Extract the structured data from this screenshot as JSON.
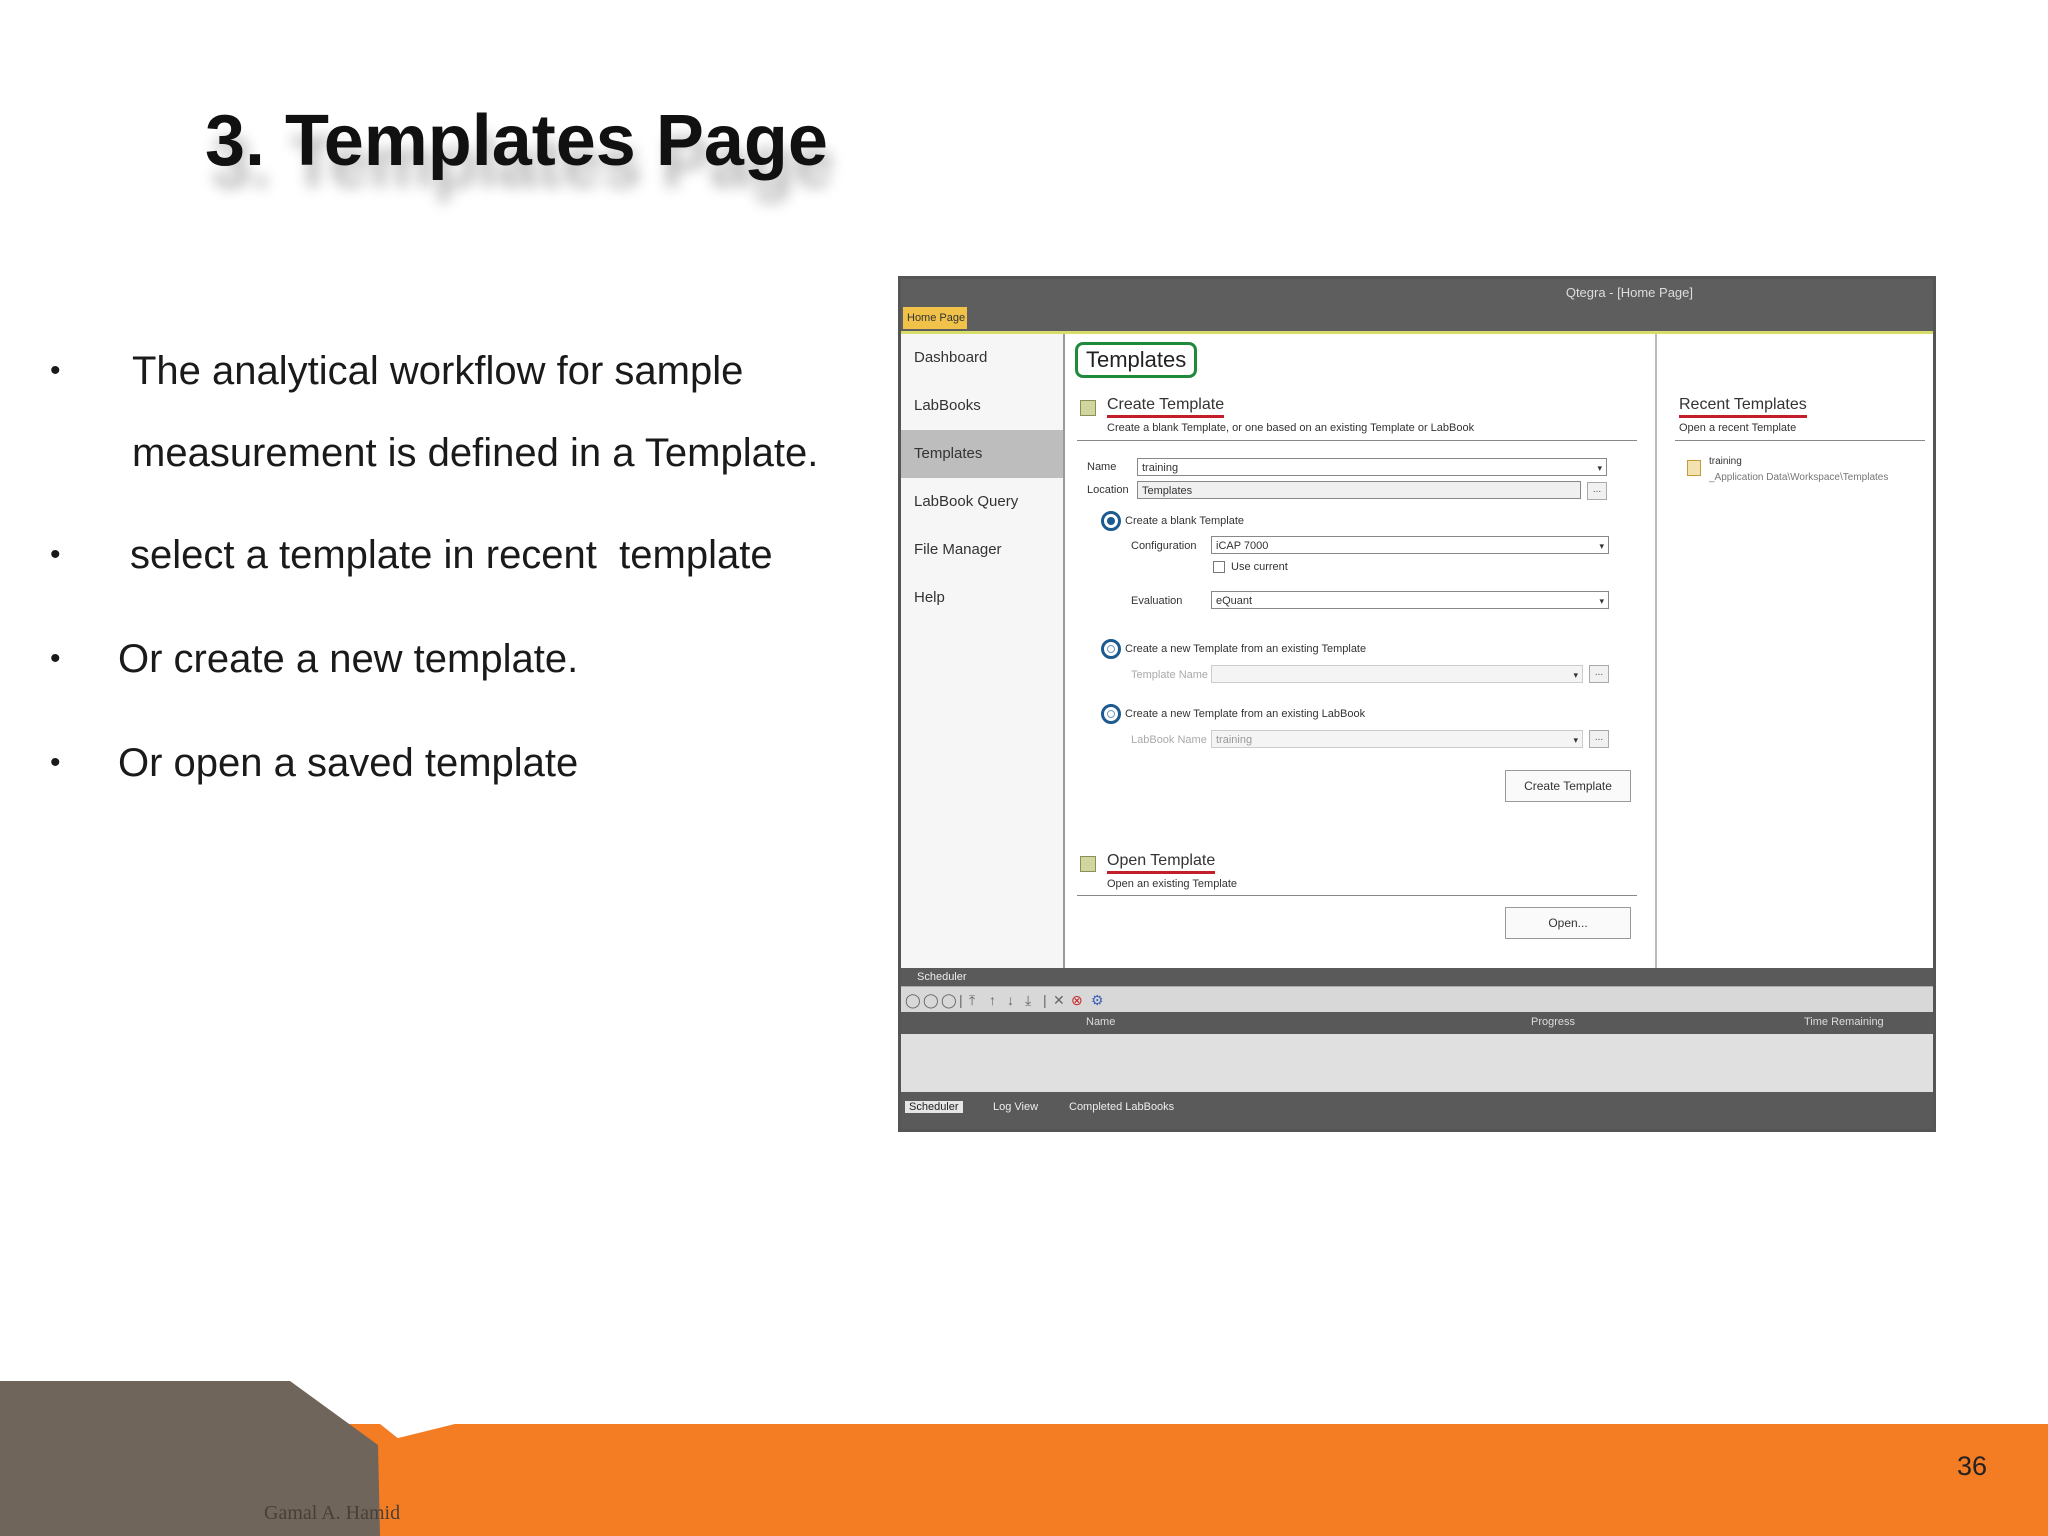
{
  "slide": {
    "title": "3. Templates Page",
    "bullets": [
      "The analytical workflow for sample measurement is defined in a Template.",
      "select a template in recent  template",
      "Or create a new template.",
      "Or open a saved template"
    ],
    "page_number": "36",
    "author": "Gamal A. Hamid"
  },
  "app": {
    "window_title": "Qtegra - [Home Page]",
    "home_tab": "Home Page",
    "nav": [
      "Dashboard",
      "LabBooks",
      "Templates",
      "LabBook Query",
      "File Manager",
      "Help"
    ],
    "active_nav": "Templates",
    "heading": "Templates",
    "create": {
      "title": "Create Template",
      "subtitle": "Create a blank Template, or one based on an existing Template or LabBook",
      "name_label": "Name",
      "name_value": "training",
      "location_label": "Location",
      "location_value": "Templates",
      "option_blank": "Create a blank Template",
      "configuration_label": "Configuration",
      "configuration_value": "iCAP 7000",
      "use_current": "Use current",
      "evaluation_label": "Evaluation",
      "evaluation_value": "eQuant",
      "option_from_template": "Create a new Template from an existing Template",
      "template_name_label": "Template Name",
      "option_from_labbook": "Create a new Template from an existing LabBook",
      "labbook_name_label": "LabBook Name",
      "labbook_name_value": "training",
      "create_button": "Create Template"
    },
    "open": {
      "title": "Open Template",
      "subtitle": "Open an existing Template",
      "open_button": "Open..."
    },
    "recent": {
      "title": "Recent Templates",
      "subtitle": "Open a recent Template",
      "item_name": "training",
      "item_path": "_Application Data\\Workspace\\Templates"
    },
    "scheduler": {
      "header": "Scheduler",
      "columns": [
        "Name",
        "Progress",
        "Time Remaining"
      ],
      "tabs": [
        "Scheduler",
        "Log View",
        "Completed LabBooks"
      ]
    }
  },
  "colors": {
    "footer_orange": "#f47c22",
    "footer_taupe": "#6f655a",
    "heading_outline": "#1f8a3a",
    "underline_red": "#c41e2a"
  }
}
